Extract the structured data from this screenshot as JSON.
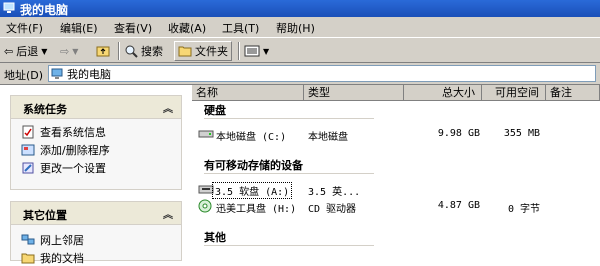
{
  "window": {
    "title": "我的电脑"
  },
  "menu": [
    "文件(F)",
    "编辑(E)",
    "查看(V)",
    "收藏(A)",
    "工具(T)",
    "帮助(H)"
  ],
  "toolbar": {
    "back": "后退",
    "search": "搜索",
    "folders": "文件夹"
  },
  "address": {
    "label": "地址(D)",
    "value": "我的电脑"
  },
  "tasks_panel": {
    "title": "系统任务",
    "items": [
      "查看系统信息",
      "添加/删除程序",
      "更改一个设置"
    ]
  },
  "places_panel": {
    "title": "其它位置",
    "items": [
      "网上邻居",
      "我的文档"
    ]
  },
  "columns": [
    "名称",
    "类型",
    "总大小",
    "可用空间",
    "备注"
  ],
  "groups": {
    "hard_disks": "硬盘",
    "removable": "有可移动存储的设备",
    "other": "其他"
  },
  "drives": [
    {
      "name": "本地磁盘 (C:)",
      "type": "本地磁盘",
      "total": "9.98 GB",
      "free": "355 MB",
      "icon": "hard-disk-icon"
    },
    {
      "name": "3.5 软盘 (A:)",
      "type": "3.5 英...",
      "total": "",
      "free": "",
      "icon": "floppy-drive-icon"
    },
    {
      "name": "迅美工具盘 (H:)",
      "type": "CD 驱动器",
      "total": "4.87 GB",
      "free": "0 字节",
      "icon": "cd-drive-icon"
    }
  ],
  "colors": {
    "title_bar": "#1a4fb8",
    "chrome": "#d4d0c8"
  }
}
